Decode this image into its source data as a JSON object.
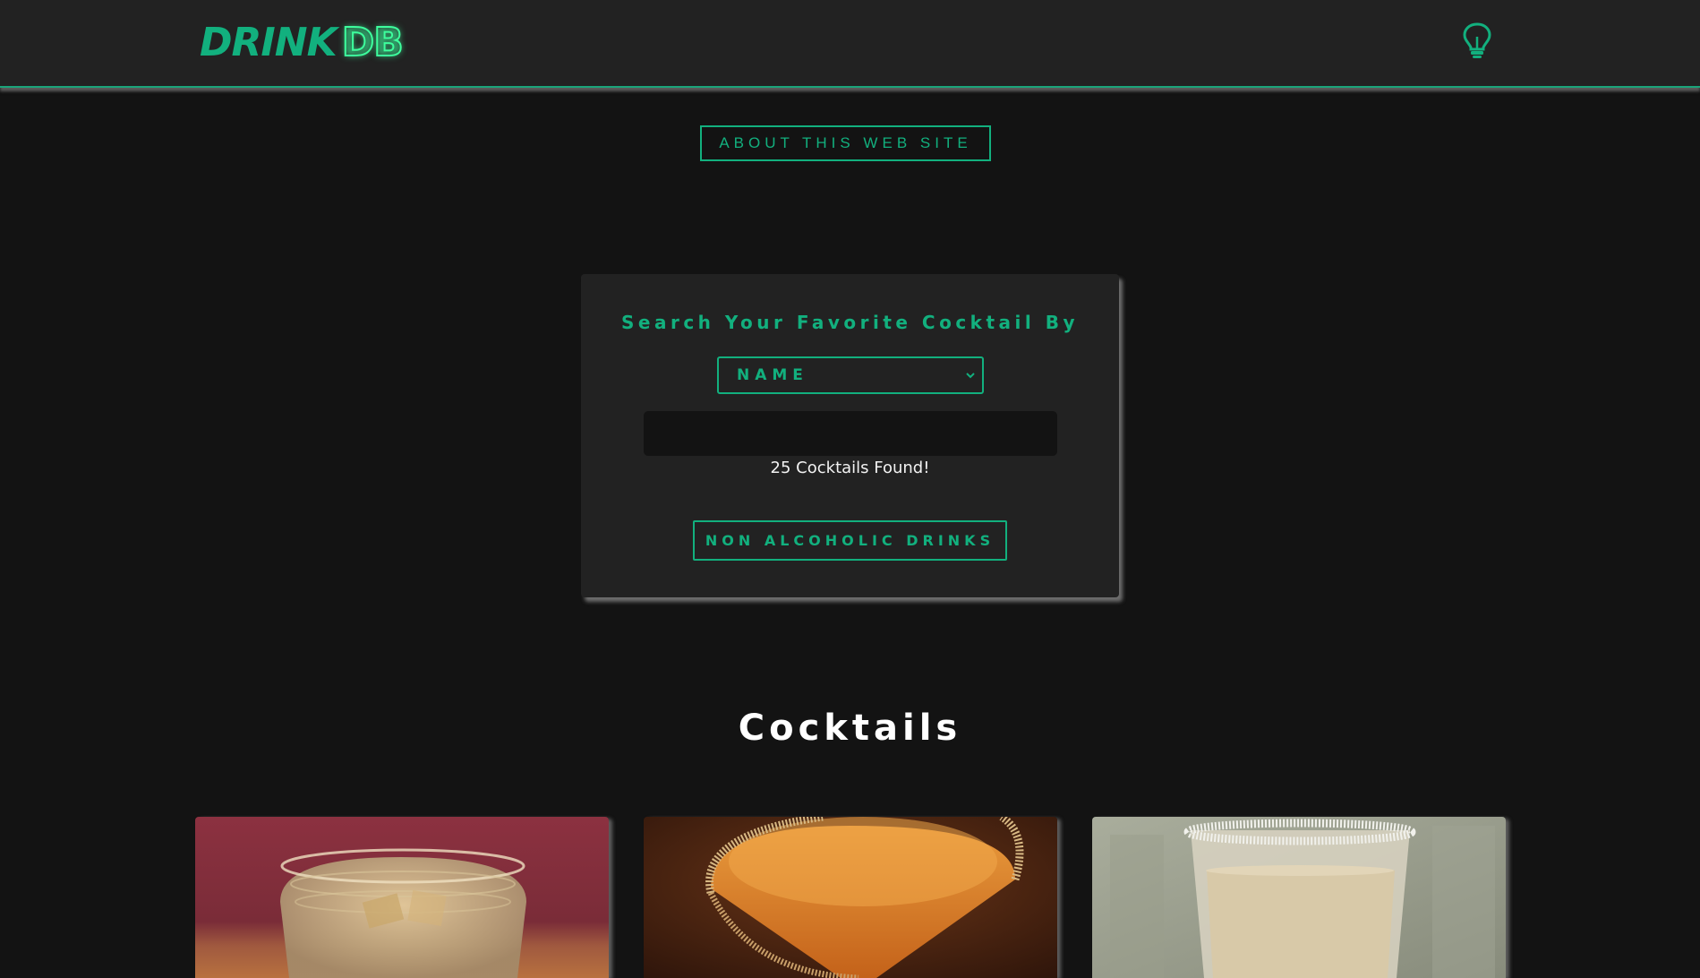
{
  "header": {
    "logo_part1": "DRINK",
    "logo_part2": "DB",
    "theme_toggle_icon": "lightbulb-icon"
  },
  "about_button_label": "ABOUT THIS WEB SITE",
  "search": {
    "title": "Search Your Favorite Cocktail By",
    "select_value": "NAME",
    "input_value": "",
    "result_count_text": "25 Cocktails Found!",
    "non_alcoholic_button_label": "NON ALCOHOLIC DRINKS"
  },
  "cocktails_section": {
    "title": "Cocktails",
    "cards": [
      {
        "image": "drink-photo-cut-glass-on-ice"
      },
      {
        "image": "drink-photo-orange-martini-sugar-rim"
      },
      {
        "image": "drink-photo-creamy-salt-rim"
      }
    ]
  },
  "colors": {
    "accent": "#12b07e",
    "neon": "#3dff9d",
    "background": "#131313",
    "panel": "#222222"
  }
}
